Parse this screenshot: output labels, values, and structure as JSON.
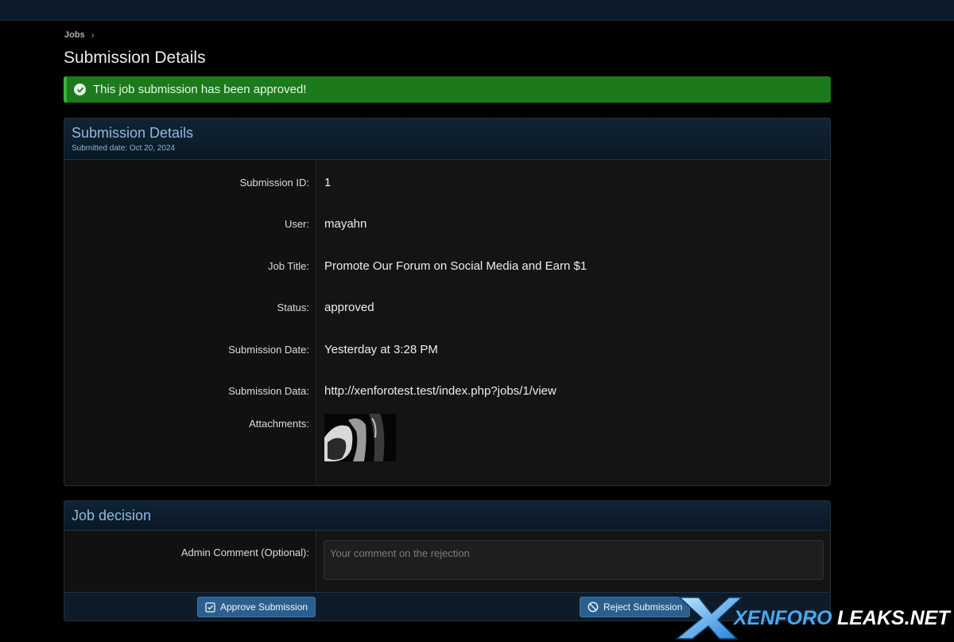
{
  "breadcrumb": {
    "item": "Jobs"
  },
  "page_title": "Submission Details",
  "alert": {
    "message": "This job submission has been approved!"
  },
  "details": {
    "title": "Submission Details",
    "submitted": "Submitted date: Oct 20, 2024",
    "rows": [
      {
        "label": "Submission ID:",
        "value": "1"
      },
      {
        "label": "User:",
        "value": "mayahn"
      },
      {
        "label": "Job Title:",
        "value": "Promote Our Forum on Social Media and Earn $1"
      },
      {
        "label": "Status:",
        "value": "approved"
      },
      {
        "label": "Submission Date:",
        "value": "Yesterday at 3:28 PM"
      },
      {
        "label": "Submission Data:",
        "value": "http://xenforotest.test/index.php?jobs/1/view"
      }
    ],
    "attachments_label": "Attachments:"
  },
  "decision": {
    "title": "Job decision",
    "comment_label": "Admin Comment (Optional):",
    "comment_placeholder": "Your comment on the rejection",
    "approve_label": "Approve Submission",
    "reject_label": "Reject Submission"
  },
  "watermark": {
    "brand": "XENFORO",
    "suffix": "LEAKS.NET"
  },
  "colors": {
    "accent": "#2c5f8d",
    "success": "#1c7a1c",
    "header_text": "#93b8db"
  }
}
